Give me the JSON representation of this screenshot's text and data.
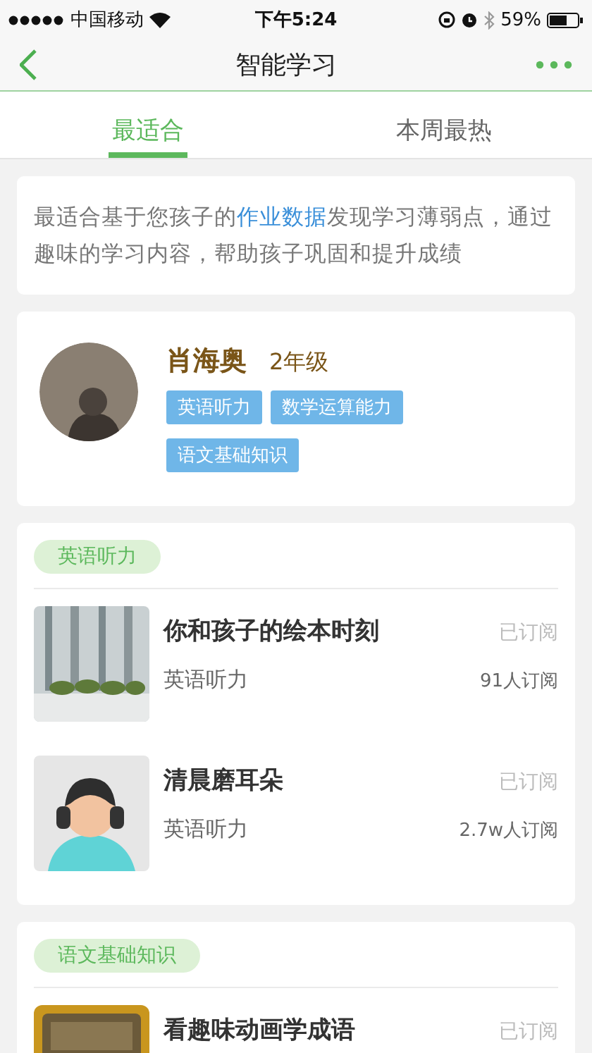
{
  "status_bar": {
    "carrier": "中国移动",
    "time": "下午5:24",
    "battery": "59%"
  },
  "nav": {
    "title": "智能学习"
  },
  "tabs": [
    {
      "label": "最适合",
      "selected": true
    },
    {
      "label": "本周最热",
      "selected": false
    }
  ],
  "intro": {
    "before": "最适合基于您孩子的",
    "link": "作业数据",
    "after": "发现学习薄弱点，通过趣味的学习内容，帮助孩子巩固和提升成绩"
  },
  "profile": {
    "name": "肖海奥",
    "grade": "2年级",
    "tags": [
      "英语听力",
      "数学运算能力",
      "语文基础知识"
    ]
  },
  "sections": [
    {
      "tag": "英语听力",
      "items": [
        {
          "title": "你和孩子的绘本时刻",
          "status": "已订阅",
          "category": "英语听力",
          "subscribers": "91人订阅"
        },
        {
          "title": "清晨磨耳朵",
          "status": "已订阅",
          "category": "英语听力",
          "subscribers": "2.7w人订阅"
        }
      ]
    },
    {
      "tag": "语文基础知识",
      "items": [
        {
          "title": "看趣味动画学成语",
          "status": "已订阅"
        }
      ]
    }
  ]
}
